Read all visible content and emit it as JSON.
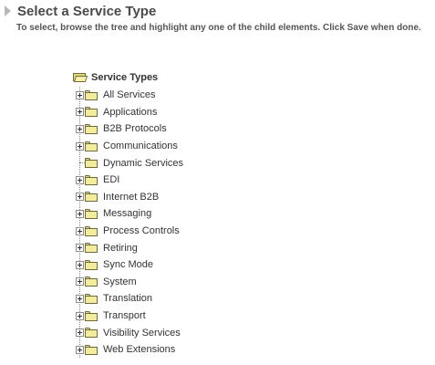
{
  "header": {
    "title": "Select a Service Type",
    "instructions": "To select, browse the tree and highlight any one of the child elements. Click Save when done."
  },
  "tree": {
    "root": {
      "label": "Service Types",
      "icon": "open-folder-icon"
    },
    "items": [
      {
        "label": "All Services",
        "expandable": true
      },
      {
        "label": "Applications",
        "expandable": true
      },
      {
        "label": "B2B Protocols",
        "expandable": true
      },
      {
        "label": "Communications",
        "expandable": true
      },
      {
        "label": "Dynamic Services",
        "expandable": false
      },
      {
        "label": "EDI",
        "expandable": true
      },
      {
        "label": "Internet B2B",
        "expandable": true
      },
      {
        "label": "Messaging",
        "expandable": true
      },
      {
        "label": "Process Controls",
        "expandable": true
      },
      {
        "label": "Retiring",
        "expandable": true
      },
      {
        "label": "Sync Mode",
        "expandable": true
      },
      {
        "label": "System",
        "expandable": true
      },
      {
        "label": "Translation",
        "expandable": true
      },
      {
        "label": "Transport",
        "expandable": true
      },
      {
        "label": "Visibility Services",
        "expandable": true
      },
      {
        "label": "Web Extensions",
        "expandable": true
      }
    ]
  },
  "colors": {
    "folder_fill": "#f2ec9c",
    "folder_outline": "#6e6a3c",
    "title_text": "#4a4a4a",
    "triangle": "#b8b8b8"
  }
}
